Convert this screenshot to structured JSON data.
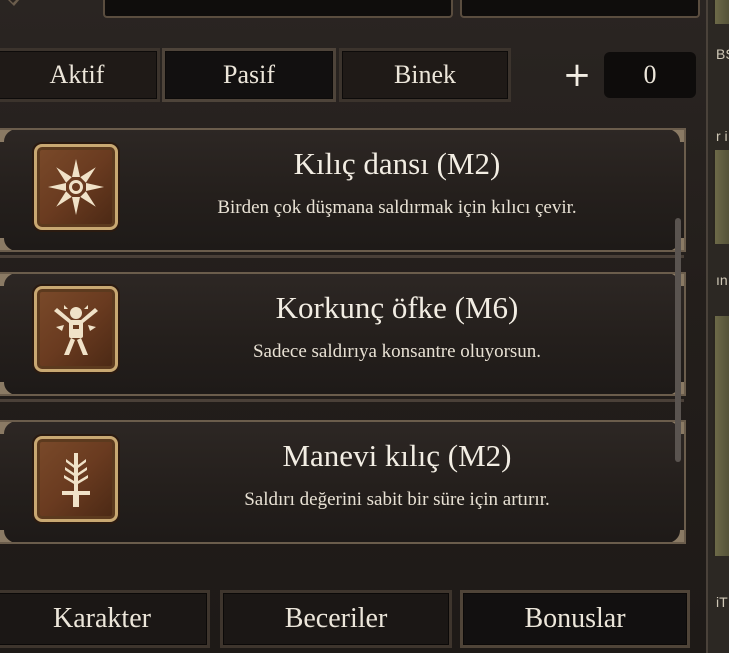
{
  "tabs": [
    {
      "label": "Aktif",
      "active": false
    },
    {
      "label": "Pasif",
      "active": true
    },
    {
      "label": "Binek",
      "active": false
    }
  ],
  "skill_points": {
    "plus": "+",
    "value": "0"
  },
  "skills": [
    {
      "title": "Kılıç dansı (M2)",
      "description": "Birden çok düşmana saldırmak için kılıcı çevir.",
      "icon": "sword-spin-icon"
    },
    {
      "title": "Korkunç öfke (M6)",
      "description": "Sadece saldırıya konsantre oluyorsun.",
      "icon": "rage-warrior-icon"
    },
    {
      "title": "Manevi kılıç (M2)",
      "description": "Saldırı değerini sabit bir süre için artırır.",
      "icon": "aura-sword-icon"
    }
  ],
  "bottom_nav": [
    {
      "label": "Karakter",
      "active": false
    },
    {
      "label": "Beceriler",
      "active": false
    },
    {
      "label": "Bonuslar",
      "active": true
    }
  ],
  "side_fragments": [
    "BS",
    "r i",
    "ın",
    "iT"
  ],
  "colors": {
    "icon_bg": "#6a3b20",
    "icon_border": "#c8a872",
    "text": "#ece6da",
    "panel_border": "#6b5d4c"
  }
}
